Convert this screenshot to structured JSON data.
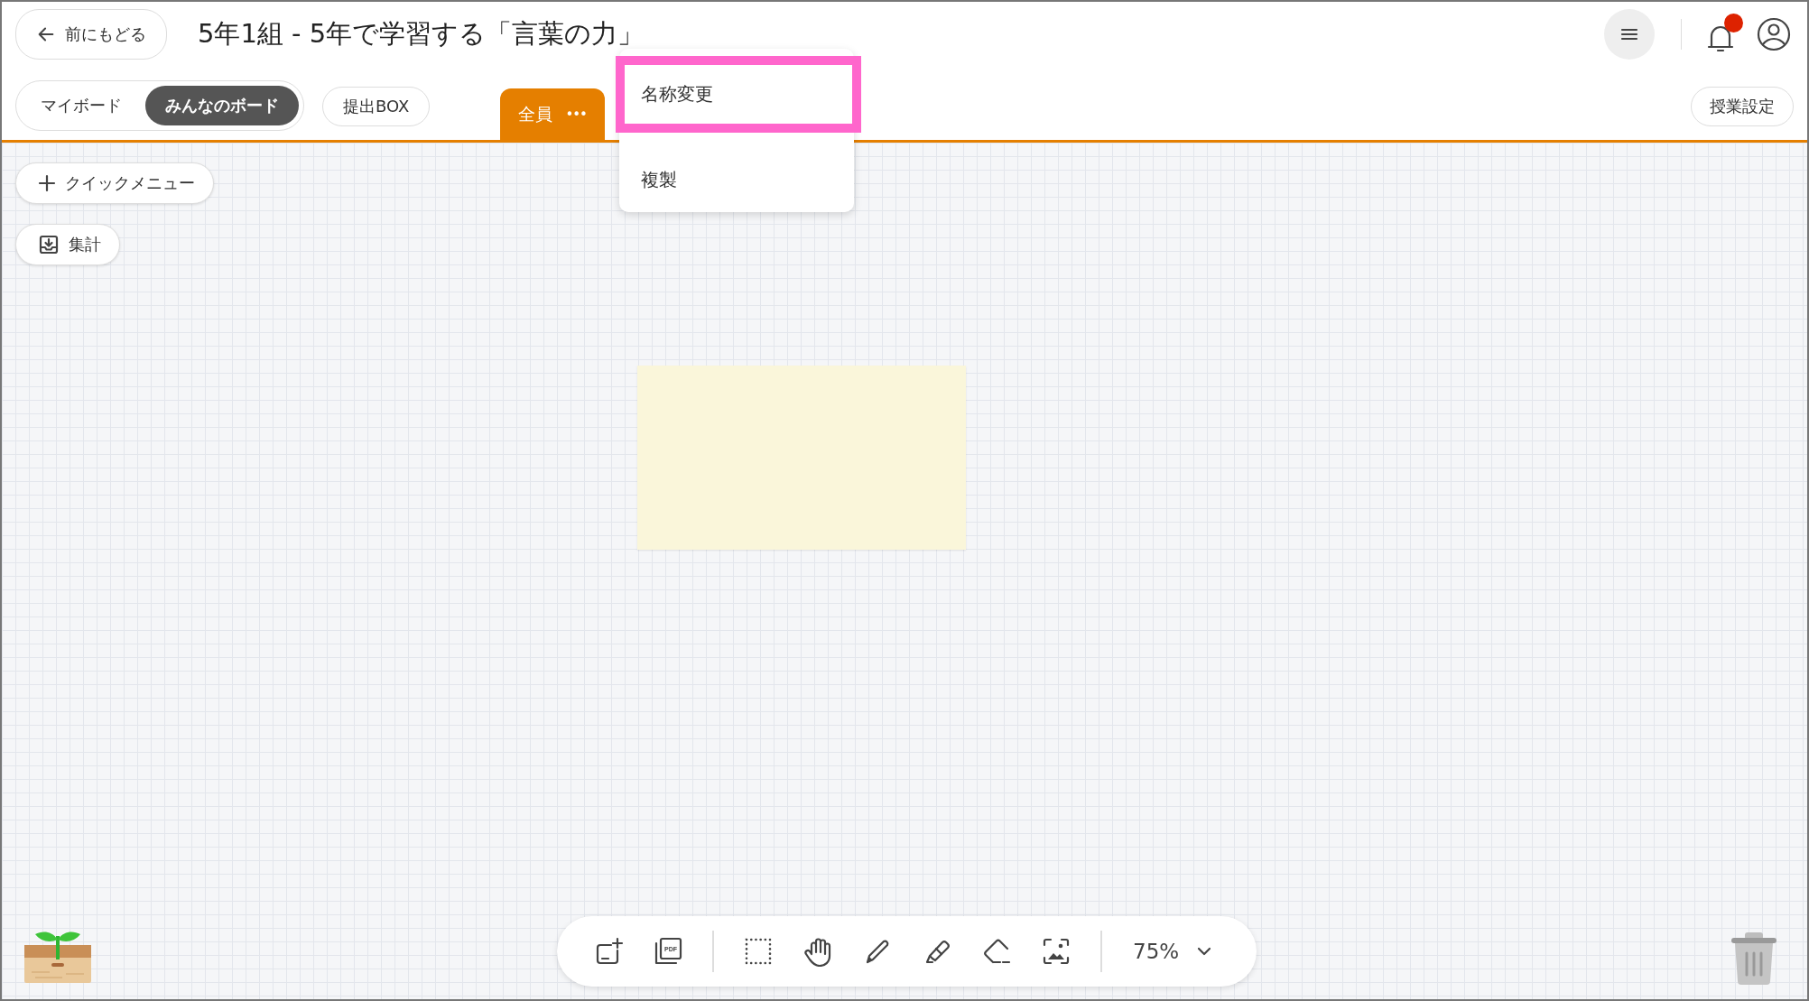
{
  "header": {
    "back_button": "前にもどる",
    "title": "5年1組 - 5年で学習する「言葉の力」",
    "notification": {
      "unread": true
    }
  },
  "board_switch": [
    {
      "label": "マイボード",
      "selected": false
    },
    {
      "label": "みんなのボード",
      "selected": true
    }
  ],
  "submit_button": "提出BOX",
  "tabs": [
    {
      "label": "全員",
      "more": "•••",
      "selected": true
    }
  ],
  "settings_button": "授業設定",
  "tab_menu": [
    {
      "label": "名称変更",
      "highlighted": true
    },
    {
      "label": "複製",
      "highlighted": false
    }
  ],
  "canvas_buttons": [
    {
      "kind": "plus",
      "label": "クイックメニュー"
    },
    {
      "kind": "download",
      "label": "集計"
    }
  ],
  "canvas": {
    "notes": [
      {
        "color": "#faf6da"
      }
    ]
  },
  "toolbar": {
    "tools": [
      {
        "kind": "add-card"
      },
      {
        "kind": "pdf",
        "label": "PDF"
      },
      {
        "kind": "divider"
      },
      {
        "kind": "select"
      },
      {
        "kind": "hand"
      },
      {
        "kind": "pen"
      },
      {
        "kind": "marker"
      },
      {
        "kind": "eraser"
      },
      {
        "kind": "image"
      },
      {
        "kind": "divider"
      }
    ],
    "zoom": "75%"
  }
}
